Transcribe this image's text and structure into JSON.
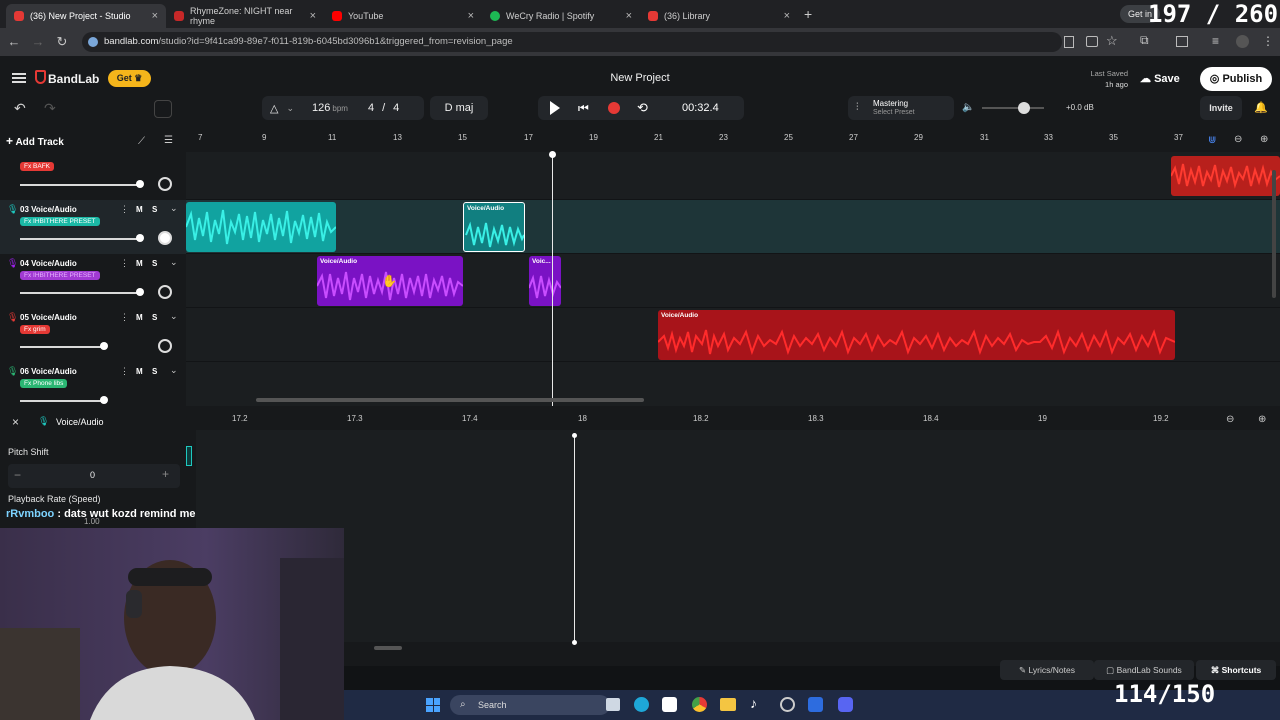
{
  "browser": {
    "tabs": [
      {
        "title": "(36) New Project - Studio",
        "active": true,
        "color": "#e53935"
      },
      {
        "title": "RhymeZone: NIGHT near rhyme",
        "active": false,
        "color": "#c62828"
      },
      {
        "title": "YouTube",
        "active": false,
        "color": "#ff0000"
      },
      {
        "title": "WeCry Radio | Spotify",
        "active": false,
        "color": "#1db954"
      },
      {
        "title": "(36) Library",
        "active": false,
        "color": "#e53935"
      }
    ],
    "new_tab": "+",
    "url_domain": "bandlab.com",
    "url_rest": "/studio?id=9f41ca99-89e7-f011-819b-6045bd3096b1&triggered_from=revision_page",
    "top_right_badge": "Get in",
    "counter_overlay": "197 / 260"
  },
  "app": {
    "brand": "BandLab",
    "get_label": "Get",
    "project_title": "New Project",
    "last_saved_label": "Last Saved",
    "last_saved_value": "1h ago",
    "save_label": "Save",
    "publish_label": "Publish",
    "invite_label": "Invite"
  },
  "transport": {
    "bpm": "126",
    "bpm_unit": "bpm",
    "time_sig_num": "4",
    "time_sig_sep": "/",
    "time_sig_den": "4",
    "key": "D maj",
    "time": "00:32.4",
    "mastering_label": "Mastering",
    "mastering_sub": "Select Preset",
    "volume_db": "+0.0 dB"
  },
  "toolbar": {
    "add_track": "Add Track"
  },
  "ruler_marks": [
    "7",
    "9",
    "11",
    "13",
    "15",
    "17",
    "19",
    "21",
    "23",
    "25",
    "27",
    "29",
    "31",
    "33",
    "35",
    "37"
  ],
  "tracks": [
    {
      "num": "",
      "name": "",
      "fx": "Fx BAFK",
      "fx_color": "#e53935"
    },
    {
      "num": "03",
      "name": "Voice/Audio",
      "fx": "Fx IHBITHERE PRESET",
      "fx_color": "#1bb9a6"
    },
    {
      "num": "04",
      "name": "Voice/Audio",
      "fx": "Fx IHBITHERE PRESET",
      "fx_color": "#a13ad3"
    },
    {
      "num": "05",
      "name": "Voice/Audio",
      "fx": "Fx grim",
      "fx_color": "#e53935"
    },
    {
      "num": "06",
      "name": "Voice/Audio",
      "fx": "Fx Phone libs",
      "fx_color": "#2bb673"
    }
  ],
  "track_buttons": {
    "mute": "M",
    "solo": "S"
  },
  "clips": {
    "c1": "Voice/Audio",
    "c2": "Voice/Audio",
    "c3": "Voice/Audio",
    "c4": "Voic...",
    "c5": "Voice/Audio"
  },
  "editor": {
    "track_name": "Voice/Audio",
    "ruler_marks": [
      "17.2",
      "17.3",
      "17.4",
      "18",
      "18.2",
      "18.3",
      "18.4",
      "19",
      "19.2"
    ],
    "pitch_label": "Pitch Shift",
    "pitch_value": "0",
    "rate_label": "Playback Rate (Speed)",
    "rate_value": "1.00",
    "chat_user": "rRvmboo",
    "chat_text": ": dats wut kozd remind me of"
  },
  "footer": {
    "lyrics": "Lyrics/Notes",
    "sounds": "BandLab Sounds",
    "shortcuts": "Shortcuts"
  },
  "taskbar": {
    "search": "Search",
    "counter": "114/150"
  },
  "colors": {
    "teal": "#1ec9c0",
    "purple": "#a020f0",
    "red": "#e0201e",
    "accent": "#e53935"
  }
}
